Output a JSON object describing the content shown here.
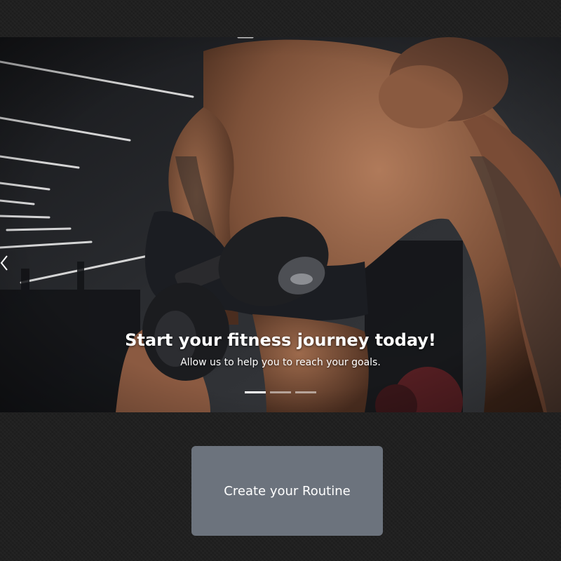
{
  "hero": {
    "title": "Start your fitness journey today!",
    "subtitle": "Allow us to help you to reach your goals.",
    "slide_count": 3,
    "active_slide": 1,
    "image_subject": "gym-dumbbell-row-photo"
  },
  "cta": {
    "label": "Create your Routine"
  },
  "colors": {
    "page_background": "#1e1e1e",
    "button_background": "#6c737d",
    "text": "#ffffff"
  }
}
